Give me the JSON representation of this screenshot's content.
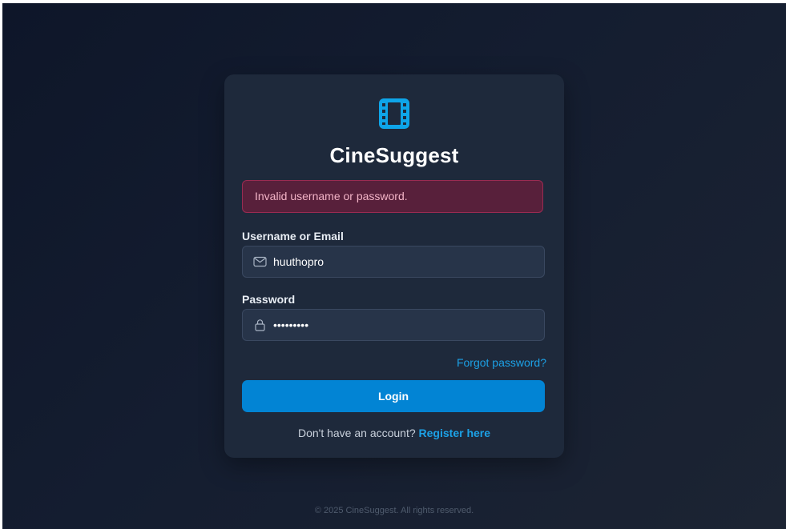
{
  "app": {
    "title": "CineSuggest",
    "icon": "film-icon",
    "brand_color": "#0ea5e9"
  },
  "alert": {
    "message": "Invalid username or password.",
    "bg_color": "#58203b",
    "border_color": "#9a2b52",
    "text_color": "#f3b4c7"
  },
  "form": {
    "username": {
      "label": "Username or Email",
      "value": "huuthopro",
      "icon": "mail-icon"
    },
    "password": {
      "label": "Password",
      "value": "•••••••••",
      "icon": "lock-icon"
    },
    "forgot_label": "Forgot password?",
    "login_label": "Login",
    "login_color": "#0284d4"
  },
  "register": {
    "prompt": "Don't have an account?",
    "link_label": "Register here"
  },
  "footer": {
    "text": "© 2025 CineSuggest. All rights reserved."
  }
}
